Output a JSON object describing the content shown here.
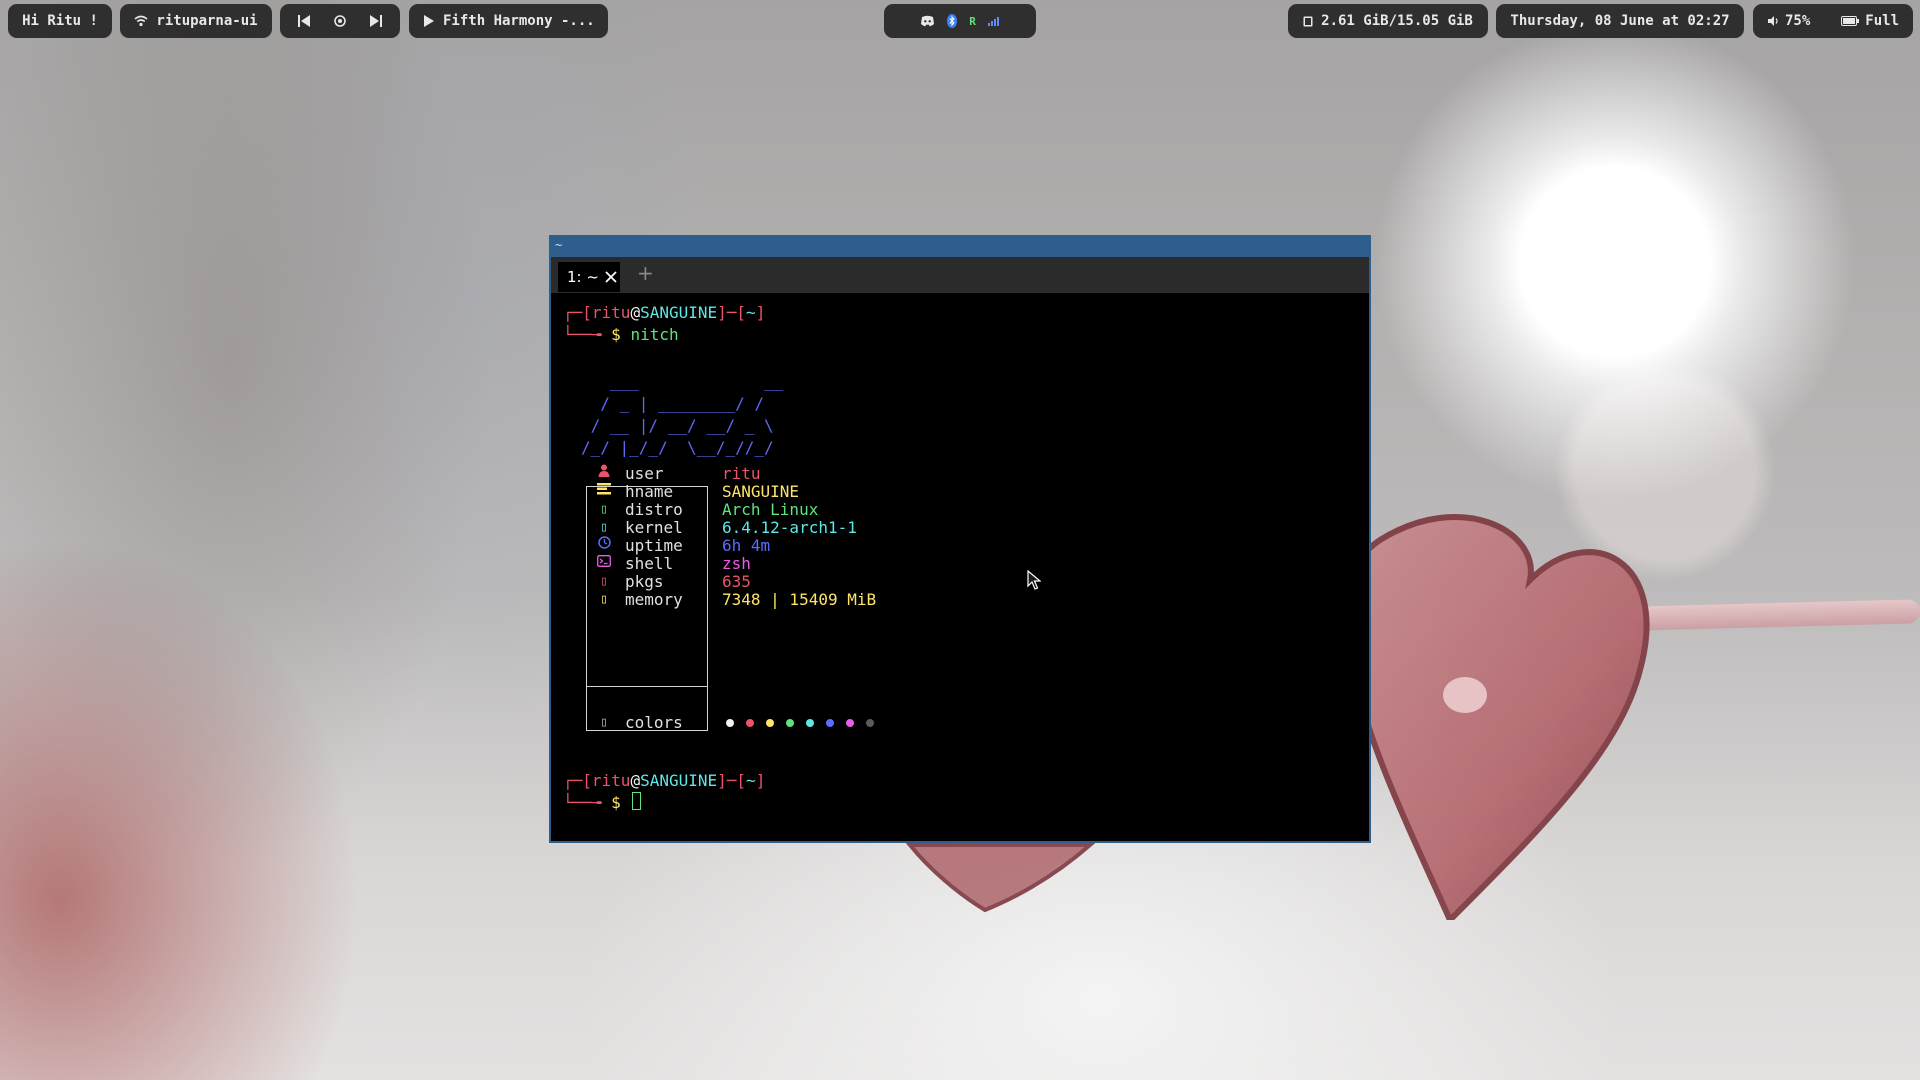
{
  "topbar": {
    "greeting": "Hi Ritu !",
    "wifi_name": "rituparna-ui",
    "now_playing": "Fifth Harmony -...",
    "memory": "2.61 GiB/15.05 GiB",
    "datetime": "Thursday, 08 June at 02:27",
    "volume": "75%",
    "battery": "Full",
    "tray_letter": "R"
  },
  "window": {
    "title": "~",
    "tab_label": "1: ~",
    "new_tab_label": "+"
  },
  "terminal": {
    "prompt": {
      "open": "┌─[",
      "user": "ritu",
      "at": "@",
      "host": "SANGUINE",
      "mid": "]─[",
      "dir": "~",
      "close": "]",
      "arrow": "└──╼ ",
      "dollar": "$"
    },
    "command": "nitch",
    "ascii_art": [
      "   ___             __",
      "  / _ | ________/ /",
      " / __ |/ __/ __/ _ \\",
      "/_/ |_/_/  \\__/_//_/"
    ],
    "info": [
      {
        "key": "user",
        "value": "ritu",
        "icon": "person-icon",
        "value_color": "#e9546b",
        "icon_color": "#e9546b"
      },
      {
        "key": "hname",
        "value": "SANGUINE",
        "icon": "bars-icon",
        "value_color": "#ffe566",
        "icon_color": "#ffe566"
      },
      {
        "key": "distro",
        "value": "Arch Linux",
        "icon": "distro-icon",
        "value_color": "#5fe37d",
        "icon_color": "#5fe37d"
      },
      {
        "key": "kernel",
        "value": "6.4.12-arch1-1",
        "icon": "kernel-icon",
        "value_color": "#5ee7e7",
        "icon_color": "#5ee7e7"
      },
      {
        "key": "uptime",
        "value": "6h 4m",
        "icon": "clock-icon",
        "value_color": "#5b6cff",
        "icon_color": "#5b6cff"
      },
      {
        "key": "shell",
        "value": "zsh",
        "icon": "terminal-icon",
        "value_color": "#e95ce9",
        "icon_color": "#e95ce9"
      },
      {
        "key": "pkgs",
        "value": "635",
        "icon": "package-icon",
        "value_color": "#e9546b",
        "icon_color": "#e9546b"
      },
      {
        "key": "memory",
        "value": "7348 | 15409 MiB",
        "icon": "memory-icon",
        "value_color": "#ffe566",
        "icon_color": "#ffe566"
      }
    ],
    "colors_label": "colors",
    "palette": [
      "#f2f2f2",
      "#e9546b",
      "#ffe566",
      "#5fe37d",
      "#5ee7e7",
      "#5b6cff",
      "#e95ce9",
      "#5a5a5a"
    ],
    "glyph_placeholder": "▯"
  }
}
